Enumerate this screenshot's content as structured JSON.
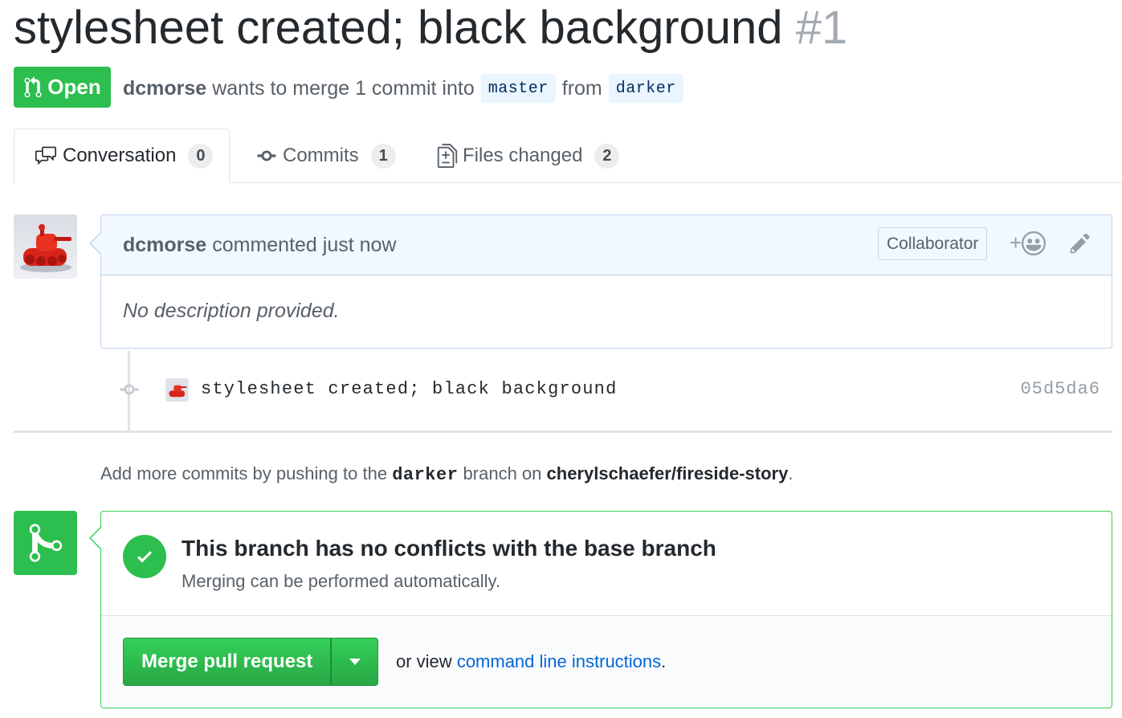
{
  "pr": {
    "title": "stylesheet created; black background",
    "number": "#1",
    "state": "Open",
    "author": "dcmorse",
    "merge_text": "wants to merge 1 commit into",
    "base_branch": "master",
    "from_text": "from",
    "head_branch": "darker"
  },
  "tabs": [
    {
      "label": "Conversation",
      "count": "0",
      "icon": "comment-discussion-icon"
    },
    {
      "label": "Commits",
      "count": "1",
      "icon": "git-commit-icon"
    },
    {
      "label": "Files changed",
      "count": "2",
      "icon": "diff-icon"
    }
  ],
  "comment": {
    "author": "dcmorse",
    "action": "commented just now",
    "role": "Collaborator",
    "body": "No description provided.",
    "react_plus": "+"
  },
  "commit": {
    "message": "stylesheet created; black background",
    "sha": "05d5da6"
  },
  "hint": {
    "prefix": "Add more commits by pushing to the",
    "branch": "darker",
    "middle": "branch on",
    "repo": "cherylschaefer/fireside-story",
    "suffix": "."
  },
  "merge": {
    "title": "This branch has no conflicts with the base branch",
    "subtitle": "Merging can be performed automatically.",
    "button": "Merge pull request",
    "alt_prefix": "or view",
    "alt_link": "command line instructions",
    "alt_suffix": "."
  },
  "colors": {
    "open_green": "#2cbe4e",
    "link_blue": "#0366d6",
    "header_blue": "#f1f8ff"
  }
}
